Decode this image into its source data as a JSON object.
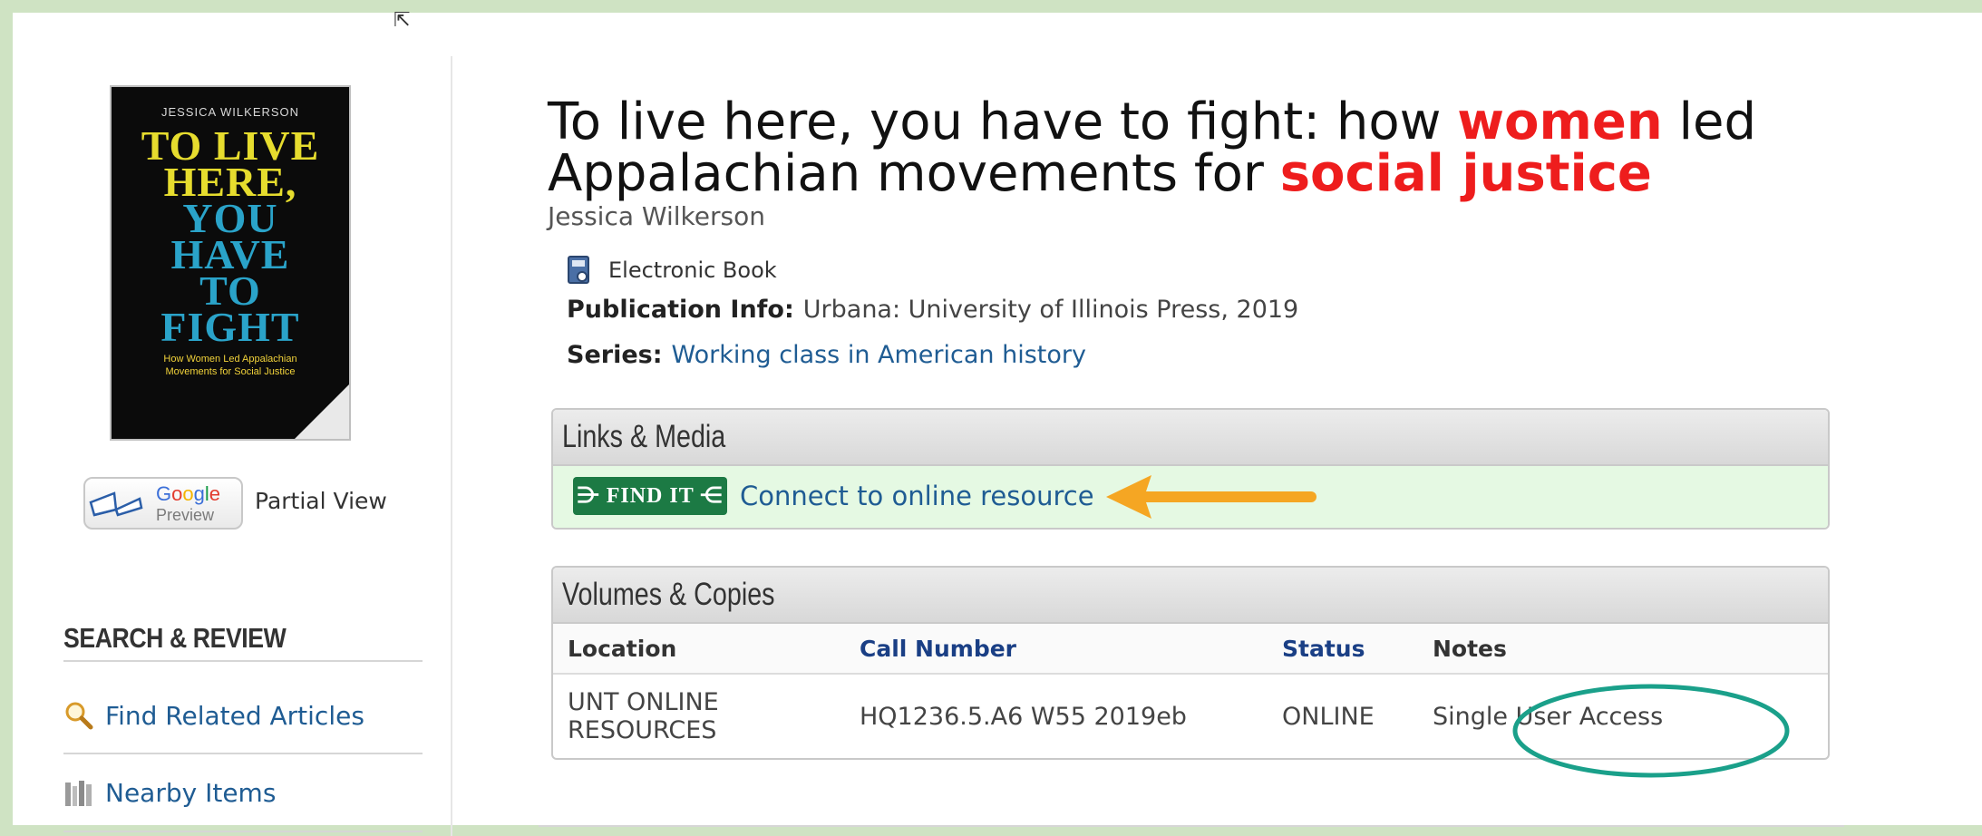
{
  "cover": {
    "author": "JESSICA WILKERSON",
    "line1": "TO LIVE",
    "line2": "HERE,",
    "line3": "YOU",
    "line4": "HAVE",
    "line5": "TO",
    "line6": "FIGHT",
    "subtitle": "How Women Led Appalachian Movements for Social Justice"
  },
  "google_preview": {
    "brand": "Google",
    "label": "Preview",
    "partial_view": "Partial View"
  },
  "sidebar": {
    "heading": "SEARCH & REVIEW",
    "items": [
      {
        "label": "Find Related Articles",
        "icon": "magnifier-icon"
      },
      {
        "label": "Nearby Items",
        "icon": "bookshelf-icon"
      }
    ]
  },
  "record": {
    "title_part1": "To live here, you have to fight: how ",
    "title_hl1": "women",
    "title_part2": " led Appalachian movements for ",
    "title_hl2": "social justice",
    "author": "Jessica Wilkerson",
    "format": "Electronic Book",
    "pub_label": "Publication Info:",
    "pub_value": "Urbana: University of Illinois Press, 2019",
    "series_label": "Series:",
    "series_value": "Working class in American history"
  },
  "links_media": {
    "heading": "Links & Media",
    "findit_label": "FIND IT",
    "connect_label": "Connect to online resource"
  },
  "volumes": {
    "heading": "Volumes & Copies",
    "columns": [
      "Location",
      "Call Number",
      "Status",
      "Notes"
    ],
    "rows": [
      [
        "UNT ONLINE RESOURCES",
        "HQ1236.5.A6 W55 2019eb",
        "ONLINE",
        "Single User Access"
      ]
    ]
  },
  "colors": {
    "highlight": "#ee1d1d",
    "link": "#1f5c93",
    "findit_green": "#1c7a44",
    "arrow_orange": "#f5a623",
    "ellipse_teal": "#1aa08a"
  }
}
